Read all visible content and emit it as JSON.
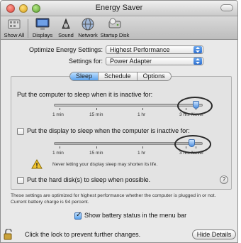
{
  "window": {
    "title": "Energy Saver"
  },
  "toolbar": {
    "items": [
      {
        "label": "Show All"
      },
      {
        "label": "Displays"
      },
      {
        "label": "Sound"
      },
      {
        "label": "Network"
      },
      {
        "label": "Startup Disk"
      }
    ]
  },
  "settings": {
    "optimize_label": "Optimize Energy Settings:",
    "optimize_value": "Highest Performance",
    "settings_for_label": "Settings for:",
    "settings_for_value": "Power Adapter"
  },
  "tabs": [
    "Sleep",
    "Schedule",
    "Options"
  ],
  "sleep": {
    "computer_label": "Put the computer to sleep when it is inactive for:",
    "computer_slider_level": "Never",
    "display_label": "Put the display to sleep when the computer is inactive for:",
    "display_checked": false,
    "display_slider_level": "3 hrs",
    "ticks": [
      "1 min",
      "15 min",
      "1 hr",
      "3 hrs",
      "Never"
    ],
    "warning_text": "Never letting your display sleep may shorten its life.",
    "harddisk_label": "Put the hard disk(s) to sleep when possible.",
    "harddisk_checked": false,
    "help_label": "?"
  },
  "info": {
    "line1": "These settings are optimized for highest performance whether the computer is plugged in or not.",
    "line2": "Current battery charge is 94 percent."
  },
  "battery": {
    "label": "Show battery status in the menu bar",
    "checked": true
  },
  "footer": {
    "lock_text": "Click the lock to prevent further changes.",
    "hide_details_label": "Hide Details"
  }
}
